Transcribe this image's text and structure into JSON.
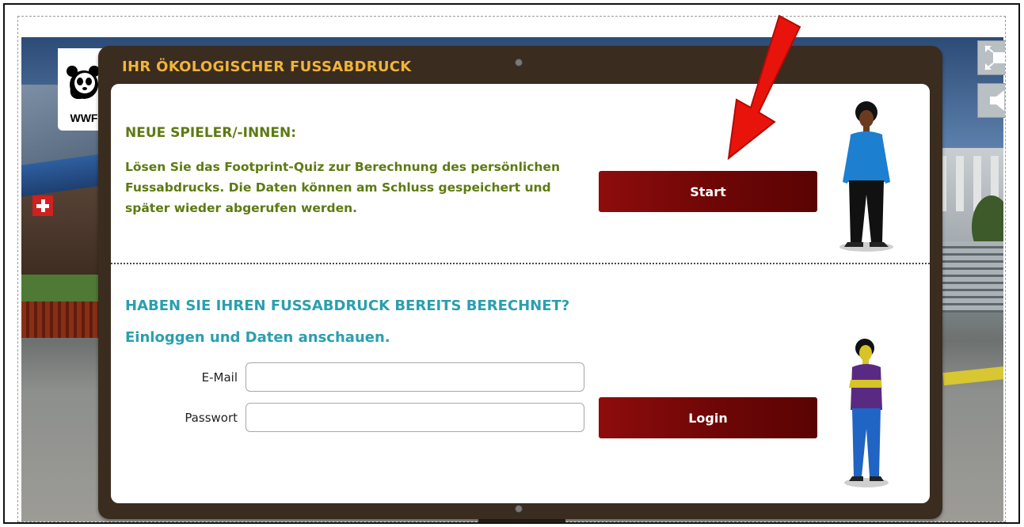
{
  "board": {
    "title": "IHR ÖKOLOGISCHER FUSSABDRUCK"
  },
  "logo": {
    "text": "WWF"
  },
  "new_players": {
    "heading": "NEUE SPIELER/-INNEN:",
    "description": "Lösen Sie das Footprint-Quiz zur Berechnung des persönlichen Fussabdrucks. Die Daten können am Schluss gespeichert und später wieder abgerufen werden.",
    "start_label": "Start"
  },
  "returning": {
    "heading": "HABEN SIE IHREN FUSSABDRUCK BEREITS BERECHNET?",
    "subheading": "Einloggen und Daten anschauen.",
    "email_label": "E-Mail",
    "email_value": "",
    "password_label": "Passwort",
    "password_value": "",
    "login_label": "Login"
  },
  "controls": {
    "fullscreen_icon": "fullscreen-icon",
    "sound_icon": "speaker-icon"
  },
  "colors": {
    "accent_title": "#f0b43a",
    "green_heading": "#5d7a12",
    "teal_heading": "#2a9fb0",
    "button_red": "#7a0808",
    "board_brown": "#3a2c1f",
    "arrow_red": "#e8140c"
  }
}
